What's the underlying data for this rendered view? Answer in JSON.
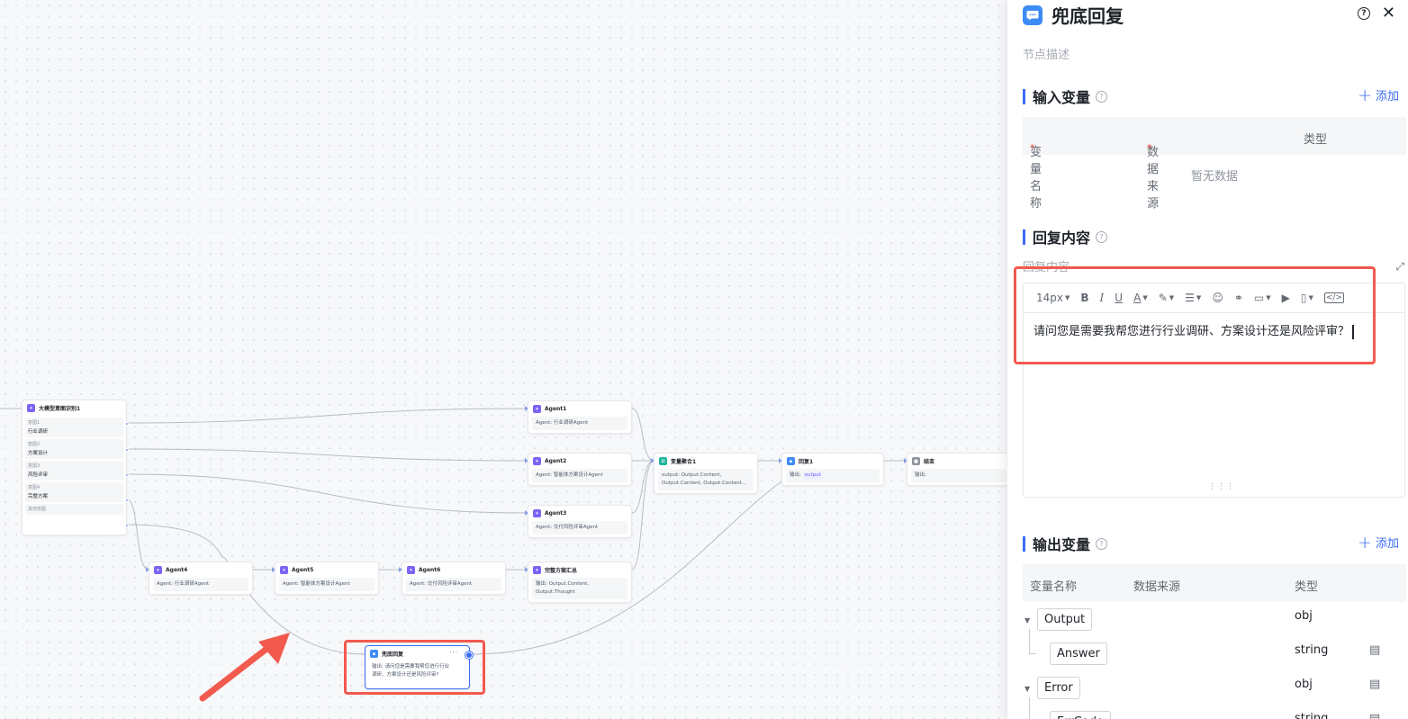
{
  "canvas": {
    "intent_node": {
      "title": "大模型意图识别1",
      "intents": [
        {
          "label": "意图1",
          "value": "行业调研"
        },
        {
          "label": "意图2",
          "value": "方案设计"
        },
        {
          "label": "意图3",
          "value": "风险评审"
        },
        {
          "label": "意图4",
          "value": "完整方案"
        }
      ],
      "other": "其他意图"
    },
    "agent_nodes": [
      {
        "title": "Agent1",
        "body": "Agent: 行业调研Agent"
      },
      {
        "title": "Agent2",
        "body": "Agent: 智能体方案设计Agent"
      },
      {
        "title": "Agent3",
        "body": "Agent: 交付风险评审Agent"
      },
      {
        "title": "Agent4",
        "body": "Agent: 行业调研Agent"
      },
      {
        "title": "Agent5",
        "body": "Agent: 智能体方案设计Agent"
      },
      {
        "title": "Agent6",
        "body": "Agent: 交付风险评审Agent"
      }
    ],
    "summary_node": {
      "title": "完整方案汇总",
      "body_1": "输出:  Output.Content,",
      "body_2": "Output.Thought"
    },
    "aggregate_node": {
      "title": "变量聚合1",
      "body_1": "output:  Output.Content,",
      "body_2": "Output.Content,  Output.Content..."
    },
    "reply1_node": {
      "title": "回复1",
      "label": "输出:",
      "tag": "output"
    },
    "end_node": {
      "title": "结束",
      "body": "输出:"
    },
    "fallback_node": {
      "title": "兜底回复",
      "more": "···",
      "body_1": "输出:  请问您是需要我帮您进行行业",
      "body_2": "调研、方案设计还是风险评审?"
    }
  },
  "panel": {
    "title": "兜底回复",
    "help": "?",
    "close": "✕",
    "description_placeholder": "节点描述",
    "input_section": {
      "title": "输入变量",
      "add": "添加",
      "columns": [
        "变量名称",
        "数据来源",
        "类型"
      ],
      "required_mark": "*",
      "empty": "暂无数据"
    },
    "reply_section": {
      "title": "回复内容",
      "field_label": "回复内容",
      "font_size": "14px",
      "content": "请问您是需要我帮您进行行业调研、方案设计还是风险评审？"
    },
    "output_section": {
      "title": "输出变量",
      "add": "添加",
      "columns": [
        "变量名称",
        "数据来源",
        "类型"
      ],
      "rows": [
        {
          "name": "Output",
          "type": "obj"
        },
        {
          "name": "Answer",
          "type": "string"
        },
        {
          "name": "Error",
          "type": "obj"
        },
        {
          "name": "ErrCode",
          "type": "string"
        }
      ]
    }
  }
}
